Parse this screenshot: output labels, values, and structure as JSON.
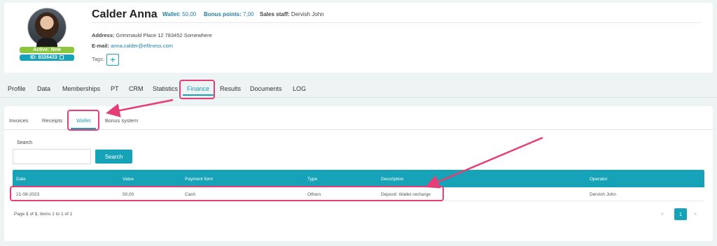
{
  "profile": {
    "name": "Calder Anna",
    "wallet_label": "Wallet:",
    "wallet_value": "50,00",
    "bonus_label": "Bonus points:",
    "bonus_value": "7,00",
    "staff_label": "Sales staff:",
    "staff_value": "Dervish John",
    "address_label": "Address:",
    "address_value": "Grimmauld Place 12 783452 Somewhere",
    "email_label": "E-mail:",
    "email_value": "anna.calder@efitness.com",
    "tags_label": "Tags:",
    "tag_add": "+",
    "status_badge": "Active: New",
    "id_badge": "ID: 8326433"
  },
  "main_tabs": [
    "Profile",
    "Data",
    "Memberships",
    "PT",
    "CRM",
    "Statistics",
    "Finance",
    "Results",
    "Documents",
    "LOG"
  ],
  "active_main_tab": "Finance",
  "sub_tabs": [
    "Invoices",
    "Receipts",
    "Wallet",
    "Bonus system"
  ],
  "active_sub_tab": "Wallet",
  "search": {
    "label": "Search",
    "value": "",
    "placeholder": "",
    "button": "Search"
  },
  "table": {
    "columns": [
      "Date",
      "Value",
      "Payment form",
      "Type",
      "Description",
      "Operator"
    ],
    "rows": [
      [
        "21-08-2023",
        "50,00",
        "Cash",
        "Others",
        "Deposit: Wallet recharge",
        "Dervish John"
      ]
    ]
  },
  "pagination": {
    "info_prefix": "Page",
    "page": "1",
    "info_of": "of",
    "pages": "1",
    "info_items": ", items",
    "from": "1",
    "info_to": "to",
    "to": "1",
    "info_of2": "of",
    "total": "1",
    "prev": "«",
    "current": "1",
    "next": "»"
  },
  "colors": {
    "accent": "#16a3b8",
    "annotation": "#e53e76",
    "active_badge": "#8cc63f"
  }
}
